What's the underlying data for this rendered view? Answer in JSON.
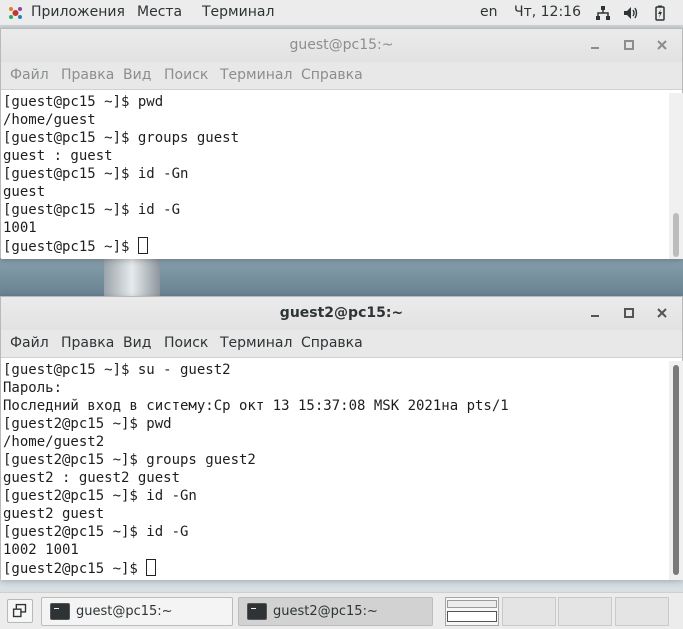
{
  "topbar": {
    "applications": "Приложения",
    "places": "Места",
    "terminal": "Терминал",
    "language": "en",
    "clock": "Чт, 12:16",
    "icons": [
      "applications-icon",
      "network-icon",
      "volume-icon",
      "battery-icon"
    ]
  },
  "window1": {
    "title": "guest@pc15:~",
    "menu": [
      "Файл",
      "Правка",
      "Вид",
      "Поиск",
      "Терминал",
      "Справка"
    ],
    "lines": [
      "[guest@pc15 ~]$ pwd",
      "/home/guest",
      "[guest@pc15 ~]$ groups guest",
      "guest : guest",
      "[guest@pc15 ~]$ id -Gn",
      "guest",
      "[guest@pc15 ~]$ id -G",
      "1001",
      "[guest@pc15 ~]$ "
    ]
  },
  "window2": {
    "title": "guest2@pc15:~",
    "menu": [
      "Файл",
      "Правка",
      "Вид",
      "Поиск",
      "Терминал",
      "Справка"
    ],
    "lines": [
      "[guest@pc15 ~]$ su - guest2",
      "Пароль:",
      "Последний вход в систему:Ср окт 13 15:37:08 MSK 2021на pts/1",
      "[guest2@pc15 ~]$ pwd",
      "/home/guest2",
      "[guest2@pc15 ~]$ groups guest2",
      "guest2 : guest2 guest",
      "[guest2@pc15 ~]$ id -Gn",
      "guest2 guest",
      "[guest2@pc15 ~]$ id -G",
      "1002 1001",
      "[guest2@pc15 ~]$ "
    ]
  },
  "taskbar": {
    "tasks": [
      "guest@pc15:~",
      "guest2@pc15:~"
    ],
    "workspaces": 4
  }
}
